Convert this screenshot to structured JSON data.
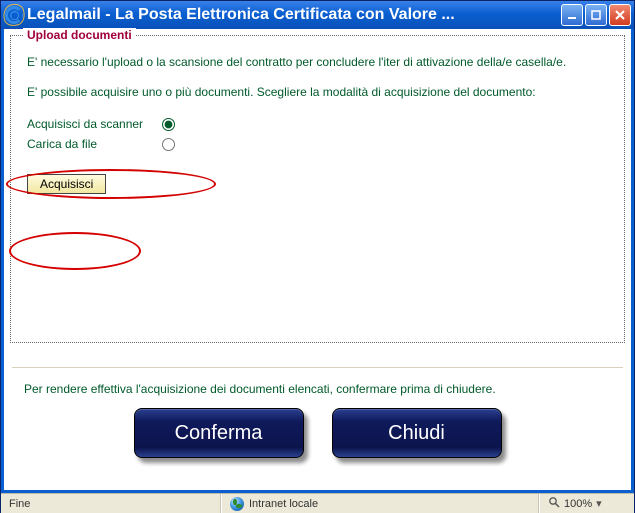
{
  "window": {
    "title": "Legalmail - La Posta Elettronica Certificata con Valore ..."
  },
  "group": {
    "legend": "Upload documenti",
    "para1": "E' necessario l'upload o la scansione del contratto per concludere l'iter di attivazione della/e casella/e.",
    "para2": "E' possibile acquisire uno o più documenti. Scegliere la modalità di acquisizione del documento:"
  },
  "options": {
    "scanner_label": "Acquisisci da scanner",
    "file_label": "Carica da file",
    "selected": "scanner"
  },
  "buttons": {
    "acquire": "Acquisisci",
    "confirm": "Conferma",
    "close": "Chiudi"
  },
  "confirm_text": "Per rendere effettiva l'acquisizione dei documenti elencati, confermare prima di chiudere.",
  "statusbar": {
    "left": "Fine",
    "zone": "Intranet locale",
    "zoom": "100%"
  }
}
